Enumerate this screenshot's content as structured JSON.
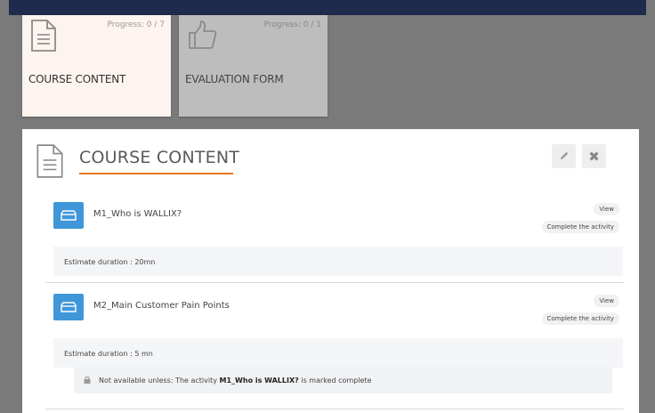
{
  "tiles": [
    {
      "label": "COURSE CONTENT",
      "progress": "Progress: 0 / 7",
      "icon": "document-icon"
    },
    {
      "label": "EVALUATION FORM",
      "progress": "Progress: 0 / 1",
      "icon": "thumbs-up-icon"
    }
  ],
  "panel": {
    "title": "COURSE CONTENT",
    "title_icon": "document-icon",
    "edit_icon": "pencil-icon",
    "close_icon": "close-icon",
    "close_glyph": "✖"
  },
  "activities": [
    {
      "name": "M1_Who is WALLIX?",
      "view_label": "View",
      "complete_label": "Complete the activity",
      "duration": "Estimate duration : 20mn"
    },
    {
      "name": "M2_Main Customer Pain Points",
      "view_label": "View",
      "complete_label": "Complete the activity",
      "duration": "Estimate duration : 5 mn",
      "restriction": {
        "prefix": "Not available unless: The activity ",
        "activity": "M1_Who is WALLIX?",
        "suffix": " is marked complete"
      }
    }
  ],
  "colors": {
    "accent_orange": "#e87722",
    "activity_blue": "#3f97d9",
    "top_bar": "#1f2b4d"
  }
}
